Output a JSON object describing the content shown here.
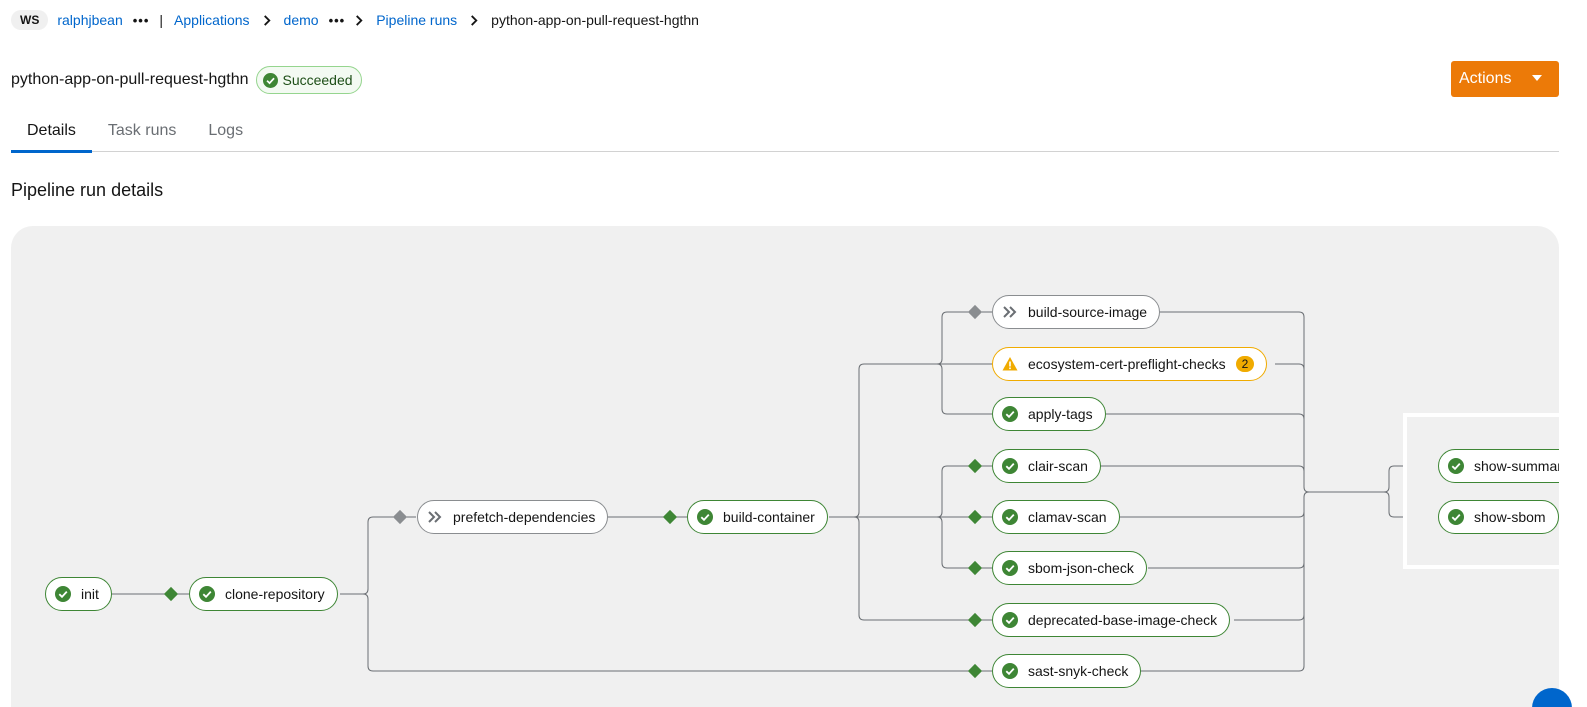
{
  "breadcrumb": {
    "ws_badge": "WS",
    "workspace": "ralphjbean",
    "more": "•••",
    "separator": "|",
    "applications": "Applications",
    "application": "demo",
    "more2": "•••",
    "pipeline_runs": "Pipeline runs",
    "current": "python-app-on-pull-request-hgthn"
  },
  "header": {
    "title": "python-app-on-pull-request-hgthn",
    "status": "Succeeded",
    "actions_label": "Actions"
  },
  "tabs": [
    {
      "label": "Details",
      "active": true
    },
    {
      "label": "Task runs",
      "active": false
    },
    {
      "label": "Logs",
      "active": false
    }
  ],
  "section_title": "Pipeline run details",
  "graph": {
    "nodes": {
      "init": {
        "label": "init",
        "status": "succeeded"
      },
      "clone_repository": {
        "label": "clone-repository",
        "status": "succeeded"
      },
      "prefetch_dependencies": {
        "label": "prefetch-dependencies",
        "status": "skipped"
      },
      "build_container": {
        "label": "build-container",
        "status": "succeeded"
      },
      "build_source_image": {
        "label": "build-source-image",
        "status": "skipped"
      },
      "ecosystem_cert_preflight_checks": {
        "label": "ecosystem-cert-preflight-checks",
        "status": "warning",
        "count": "2"
      },
      "apply_tags": {
        "label": "apply-tags",
        "status": "succeeded"
      },
      "clair_scan": {
        "label": "clair-scan",
        "status": "succeeded"
      },
      "clamav_scan": {
        "label": "clamav-scan",
        "status": "succeeded"
      },
      "sbom_json_check": {
        "label": "sbom-json-check",
        "status": "succeeded"
      },
      "deprecated_base_image_check": {
        "label": "deprecated-base-image-check",
        "status": "succeeded"
      },
      "sast_snyk_check": {
        "label": "sast-snyk-check",
        "status": "succeeded"
      },
      "show_summary": {
        "label": "show-summary",
        "status": "succeeded"
      },
      "show_sbom": {
        "label": "show-sbom",
        "status": "succeeded"
      }
    },
    "colors": {
      "success": "#3e8635",
      "warning": "#f0ab00",
      "skipped": "#8a8d90",
      "edge": "#6a6e73",
      "background": "#f0f0f0"
    }
  }
}
